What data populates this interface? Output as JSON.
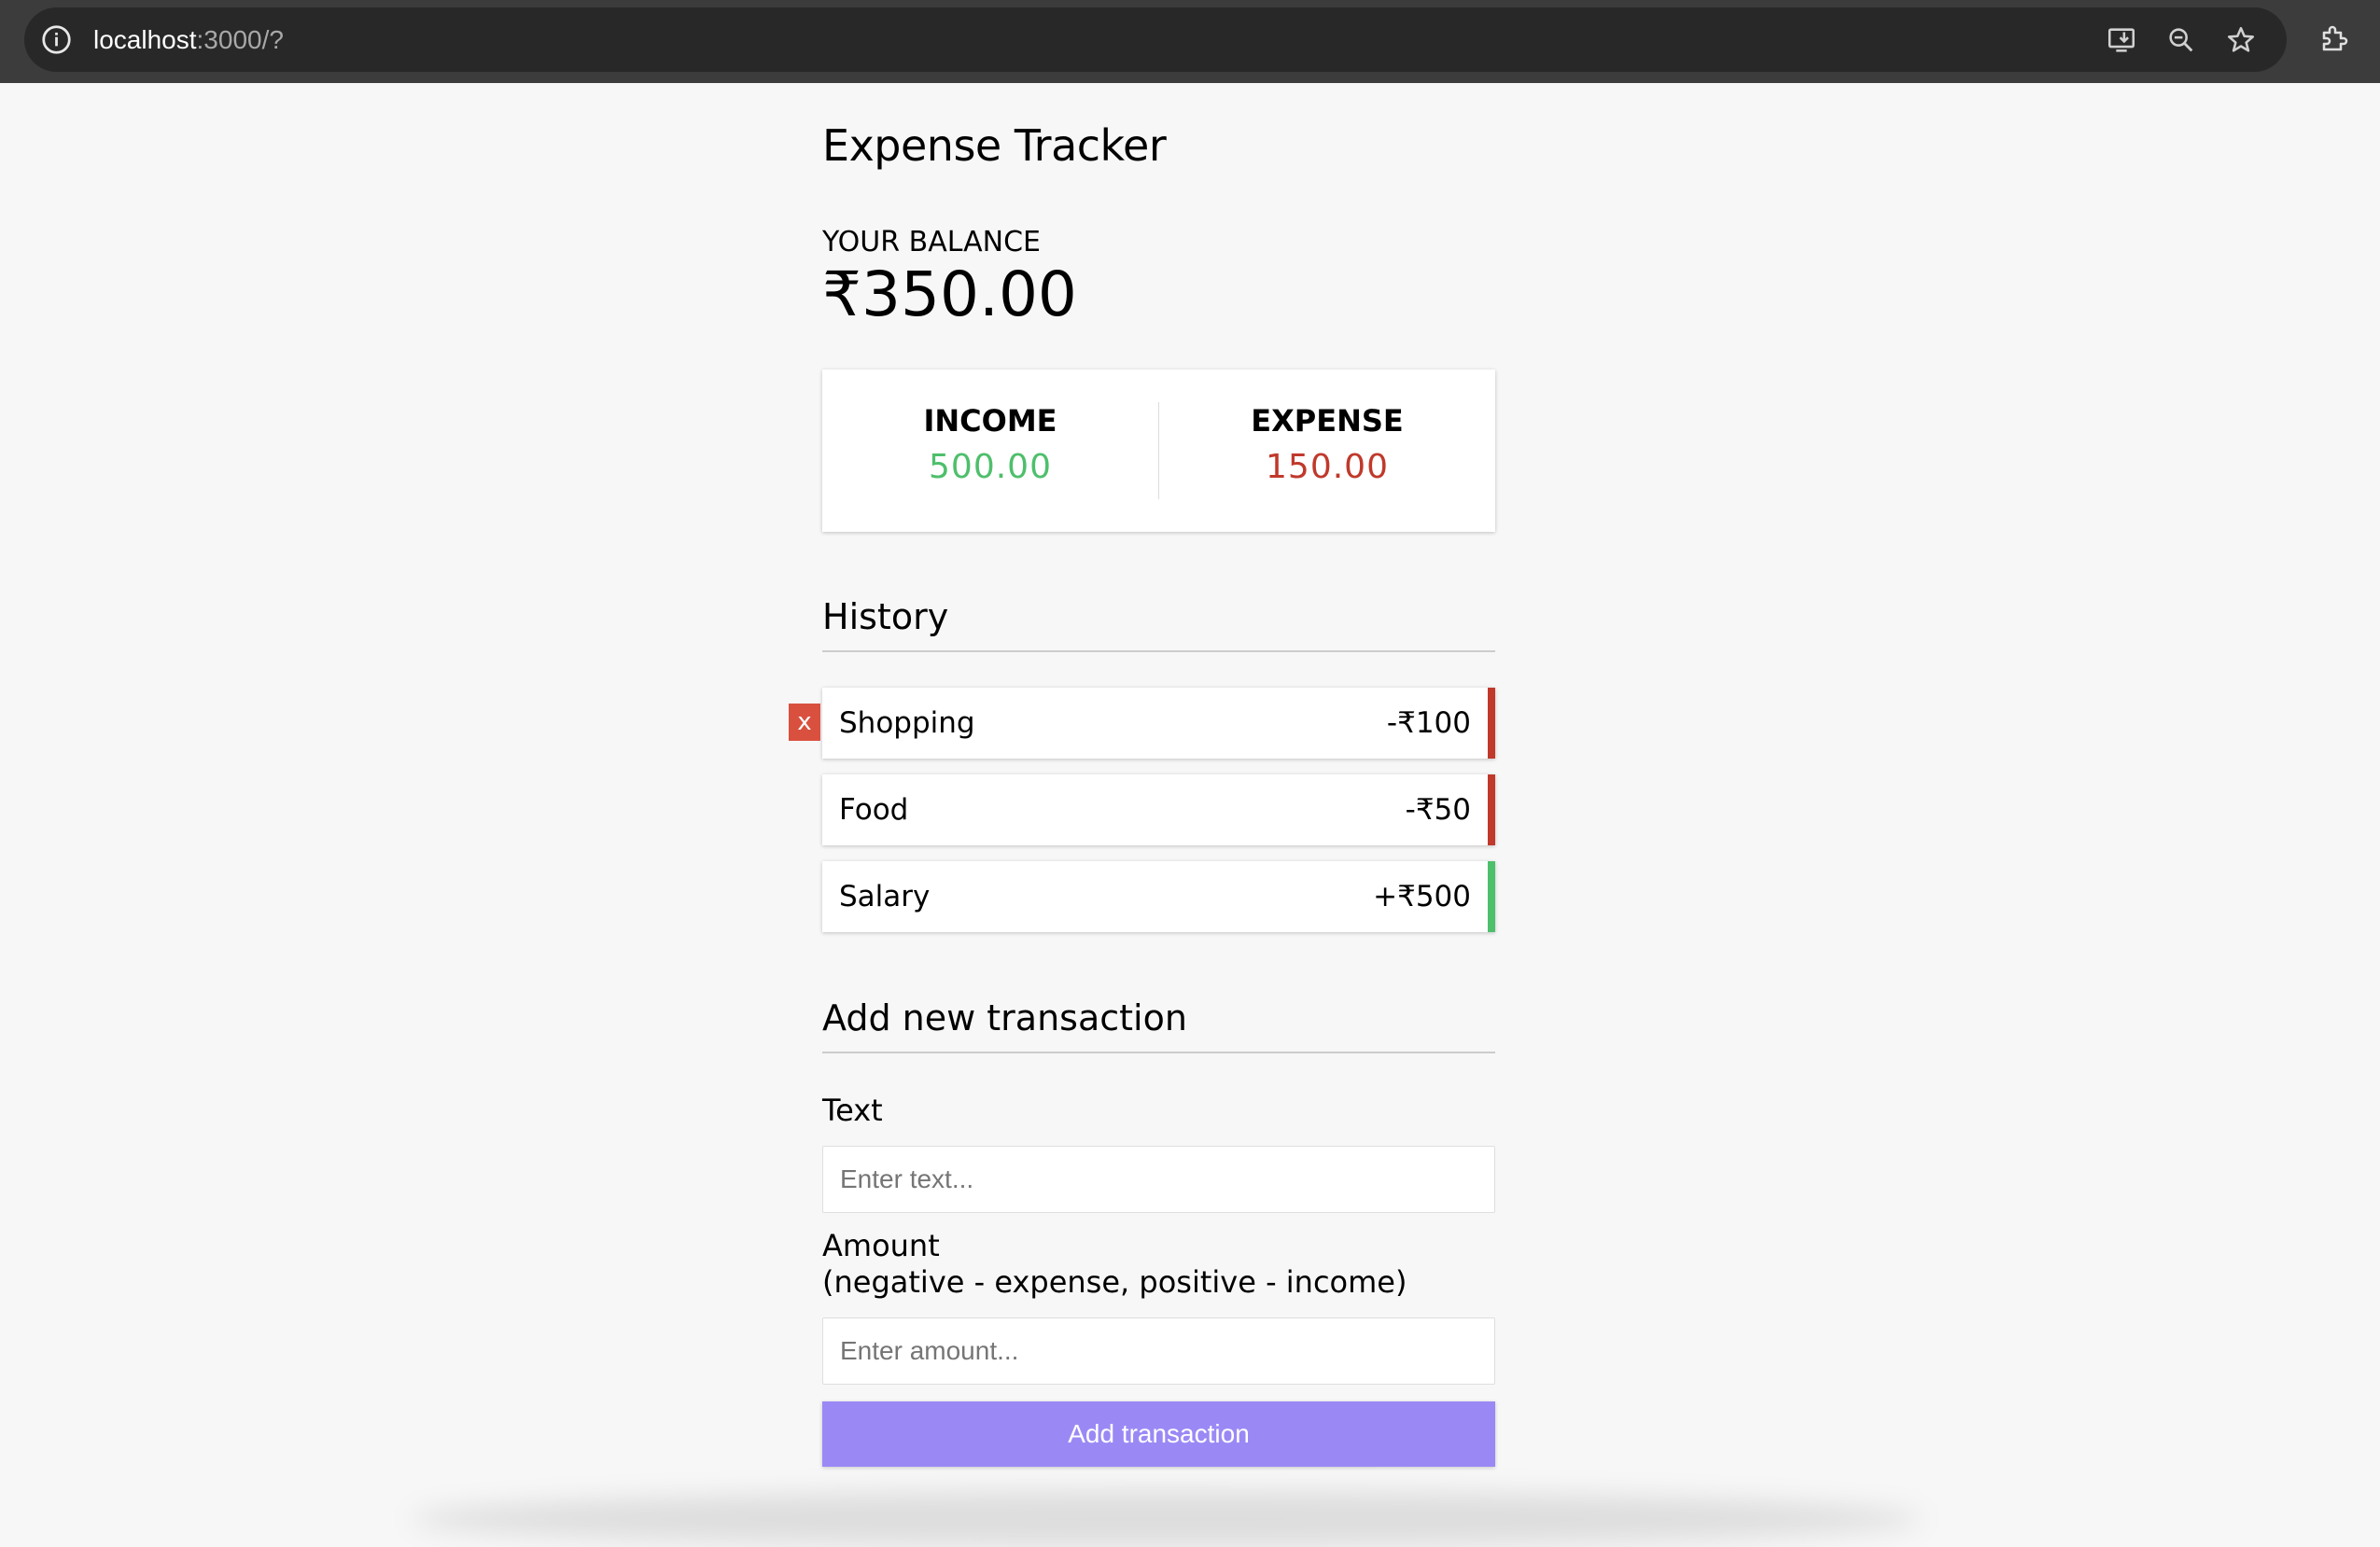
{
  "browser": {
    "url_host": "localhost",
    "url_path": ":3000/?",
    "icons": [
      "info-icon",
      "install-app-icon",
      "zoom-out-icon",
      "bookmark-star-icon",
      "extensions-icon"
    ]
  },
  "app": {
    "title": "Expense Tracker",
    "balance_label": "YOUR BALANCE",
    "balance_value": "₹350.00",
    "income_label": "INCOME",
    "income_value": "500.00",
    "expense_label": "EXPENSE",
    "expense_value": "150.00"
  },
  "history": {
    "title": "History",
    "delete_label": "x",
    "items": [
      {
        "text": "Shopping",
        "amount": "-₹100",
        "type": "minus"
      },
      {
        "text": "Food",
        "amount": "-₹50",
        "type": "minus"
      },
      {
        "text": "Salary",
        "amount": "+₹500",
        "type": "plus"
      }
    ]
  },
  "form": {
    "title": "Add new transaction",
    "text_label": "Text",
    "text_placeholder": "Enter text...",
    "amount_label": "Amount",
    "amount_hint": "(negative - expense, positive - income)",
    "amount_placeholder": "Enter amount...",
    "submit_label": "Add transaction"
  },
  "colors": {
    "income": "#4ebf6b",
    "expense": "#c0392b",
    "button": "#9a89f5",
    "delete": "#d9503f"
  }
}
